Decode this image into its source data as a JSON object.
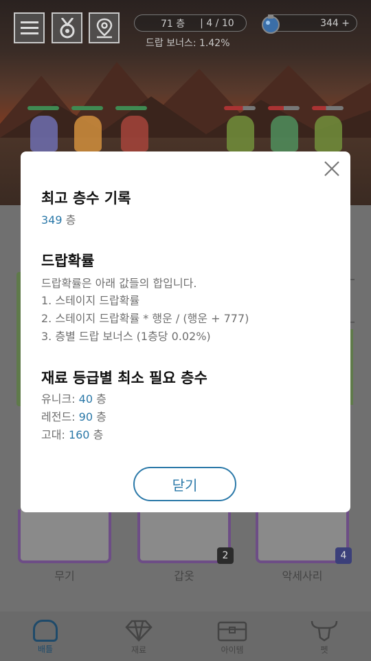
{
  "hud": {
    "floor": "71 층",
    "wave": "| 4 / 10",
    "drop_bonus": "드랍 보너스: 1.42%",
    "currency": "344 +"
  },
  "equipment": {
    "slots": [
      {
        "label": "무기",
        "count": ""
      },
      {
        "label": "갑옷",
        "count": "2"
      },
      {
        "label": "악세사리",
        "count": "4"
      }
    ]
  },
  "nav": {
    "items": [
      {
        "label": "배틀"
      },
      {
        "label": "재료"
      },
      {
        "label": "아이템"
      },
      {
        "label": "펫"
      }
    ]
  },
  "modal": {
    "best_floor_title": "최고 층수 기록",
    "best_floor_value": "349",
    "best_floor_unit": "층",
    "drop_title": "드랍확률",
    "drop_lines": [
      "드랍확률은 아래 값들의 합입니다.",
      "1. 스테이지 드랍확률",
      "2. 스테이지 드랍확률 * 행운 / (행운 + 777)",
      "3. 층별 드랍 보너스 (1층당 0.02%)"
    ],
    "grade_title": "재료 등급별 최소 필요 층수",
    "grades": [
      {
        "name": "유니크:",
        "value": "40",
        "unit": "층"
      },
      {
        "name": "레전드:",
        "value": "90",
        "unit": "층"
      },
      {
        "name": "고대:",
        "value": "160",
        "unit": "층"
      }
    ],
    "close_button": "닫기"
  },
  "colors": {
    "accent": "#2a78a8",
    "equipment_border": "#6d4d86"
  }
}
